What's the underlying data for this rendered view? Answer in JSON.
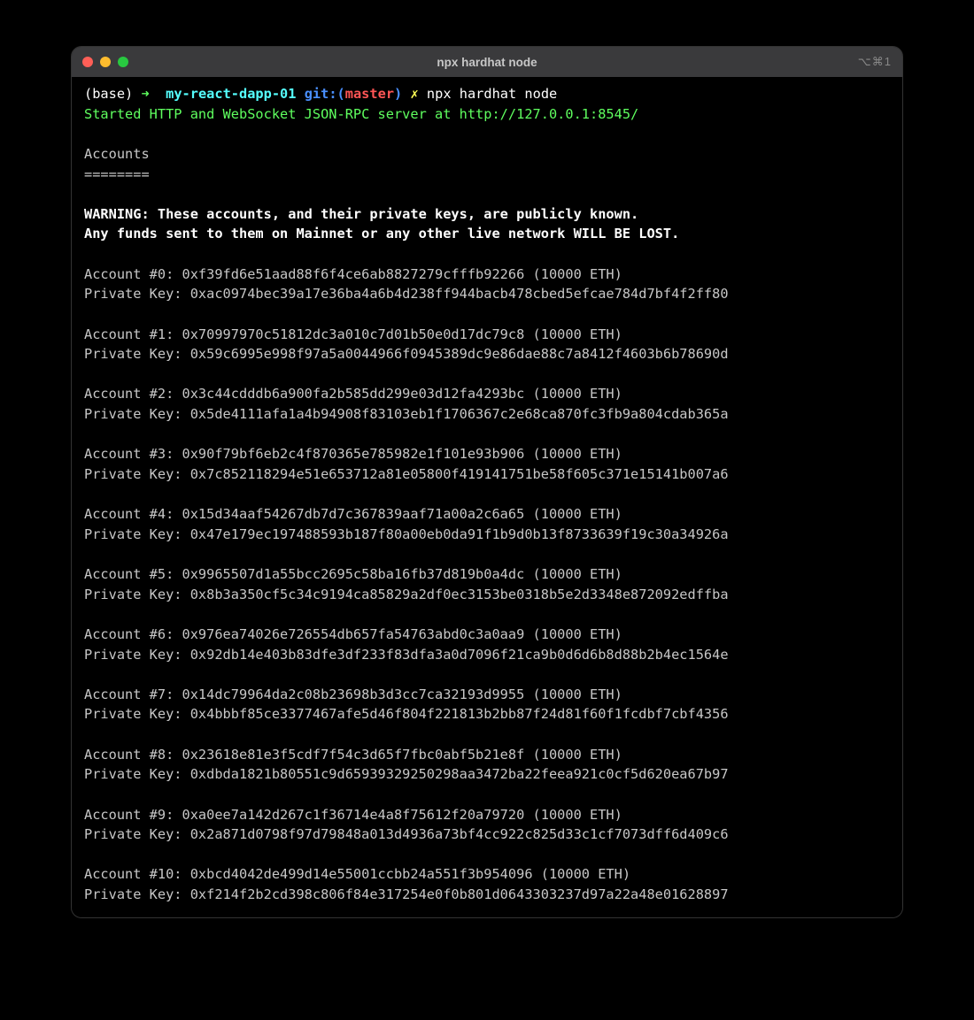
{
  "window": {
    "title": "npx hardhat node",
    "tab_indicator": "⌥⌘1"
  },
  "prompt": {
    "env": "(base)",
    "arrow": "➜",
    "path": "my-react-dapp-01",
    "git_label": "git:",
    "branch": "master",
    "dirty_marker": "✗",
    "command": "npx hardhat node"
  },
  "started_line": "Started HTTP and WebSocket JSON-RPC server at http://127.0.0.1:8545/",
  "section_header": "Accounts",
  "section_divider": "========",
  "warning_line1": "WARNING: These accounts, and their private keys, are publicly known.",
  "warning_line2": "Any funds sent to them on Mainnet or any other live network WILL BE LOST.",
  "balance_suffix": "(10000 ETH)",
  "accounts": [
    {
      "index": 0,
      "address": "0xf39fd6e51aad88f6f4ce6ab8827279cfffb92266",
      "private_key": "0xac0974bec39a17e36ba4a6b4d238ff944bacb478cbed5efcae784d7bf4f2ff80"
    },
    {
      "index": 1,
      "address": "0x70997970c51812dc3a010c7d01b50e0d17dc79c8",
      "private_key": "0x59c6995e998f97a5a0044966f0945389dc9e86dae88c7a8412f4603b6b78690d"
    },
    {
      "index": 2,
      "address": "0x3c44cdddb6a900fa2b585dd299e03d12fa4293bc",
      "private_key": "0x5de4111afa1a4b94908f83103eb1f1706367c2e68ca870fc3fb9a804cdab365a"
    },
    {
      "index": 3,
      "address": "0x90f79bf6eb2c4f870365e785982e1f101e93b906",
      "private_key": "0x7c852118294e51e653712a81e05800f419141751be58f605c371e15141b007a6"
    },
    {
      "index": 4,
      "address": "0x15d34aaf54267db7d7c367839aaf71a00a2c6a65",
      "private_key": "0x47e179ec197488593b187f80a00eb0da91f1b9d0b13f8733639f19c30a34926a"
    },
    {
      "index": 5,
      "address": "0x9965507d1a55bcc2695c58ba16fb37d819b0a4dc",
      "private_key": "0x8b3a350cf5c34c9194ca85829a2df0ec3153be0318b5e2d3348e872092edffba"
    },
    {
      "index": 6,
      "address": "0x976ea74026e726554db657fa54763abd0c3a0aa9",
      "private_key": "0x92db14e403b83dfe3df233f83dfa3a0d7096f21ca9b0d6d6b8d88b2b4ec1564e"
    },
    {
      "index": 7,
      "address": "0x14dc79964da2c08b23698b3d3cc7ca32193d9955",
      "private_key": "0x4bbbf85ce3377467afe5d46f804f221813b2bb87f24d81f60f1fcdbf7cbf4356"
    },
    {
      "index": 8,
      "address": "0x23618e81e3f5cdf7f54c3d65f7fbc0abf5b21e8f",
      "private_key": "0xdbda1821b80551c9d65939329250298aa3472ba22feea921c0cf5d620ea67b97"
    },
    {
      "index": 9,
      "address": "0xa0ee7a142d267c1f36714e4a8f75612f20a79720",
      "private_key": "0x2a871d0798f97d79848a013d4936a73bf4cc922c825d33c1cf7073dff6d409c6"
    },
    {
      "index": 10,
      "address": "0xbcd4042de499d14e55001ccbb24a551f3b954096",
      "private_key": "0xf214f2b2cd398c806f84e317254e0f0b801d0643303237d97a22a48e01628897"
    }
  ]
}
